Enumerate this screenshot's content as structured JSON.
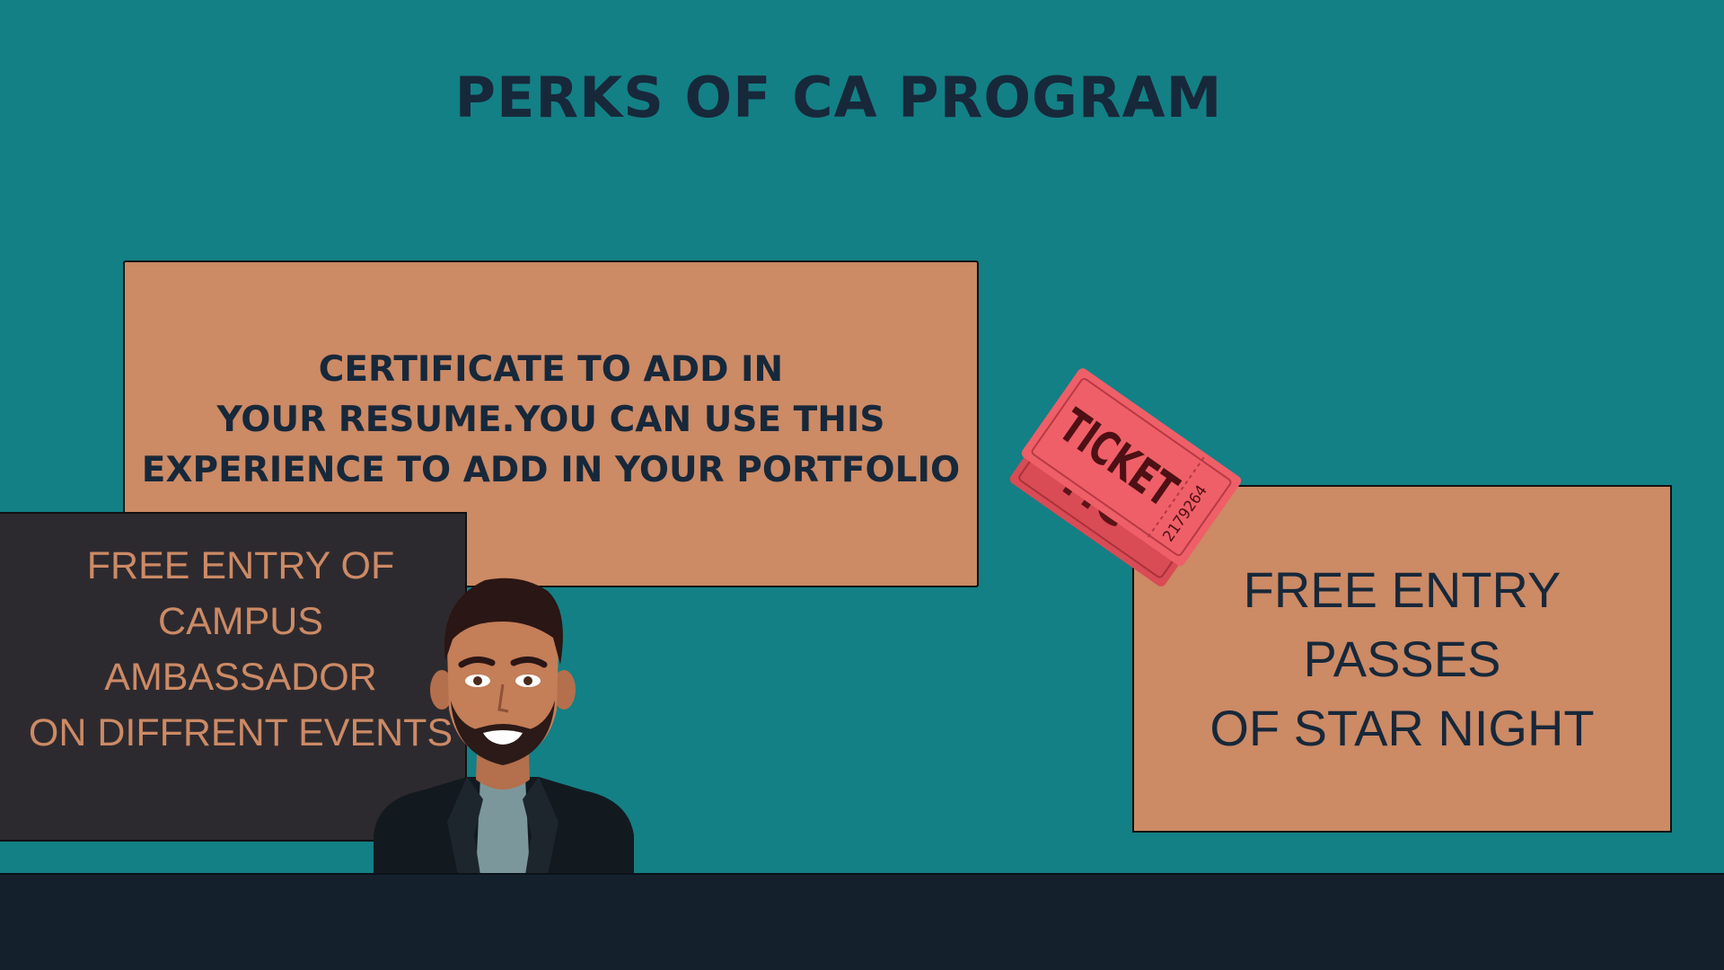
{
  "title": "PERKS OF CA PROGRAM",
  "cards": {
    "certificate": {
      "lines": [
        "CERTIFICATE TO ADD IN",
        "YOUR RESUME.YOU CAN USE THIS",
        "EXPERIENCE TO ADD IN YOUR PORTFOLIO"
      ]
    },
    "campus": {
      "lines": [
        "FREE ENTRY OF CAMPUS",
        "AMBASSADOR",
        "ON DIFFRENT EVENTS"
      ]
    },
    "star_night": {
      "lines": [
        "FREE ENTRY",
        "PASSES",
        "OF STAR NIGHT"
      ]
    }
  },
  "ticket": {
    "label": "TICKET",
    "number": "2179264",
    "color": "#e85a62"
  },
  "colors": {
    "background": "#138085",
    "card": "#cc8a65",
    "dark_card": "#2d2a2f",
    "text_dark": "#17283a",
    "floor": "#14212d"
  },
  "icons": {
    "ticket": "ticket-icon",
    "avatar": "bearded-man-avatar"
  }
}
